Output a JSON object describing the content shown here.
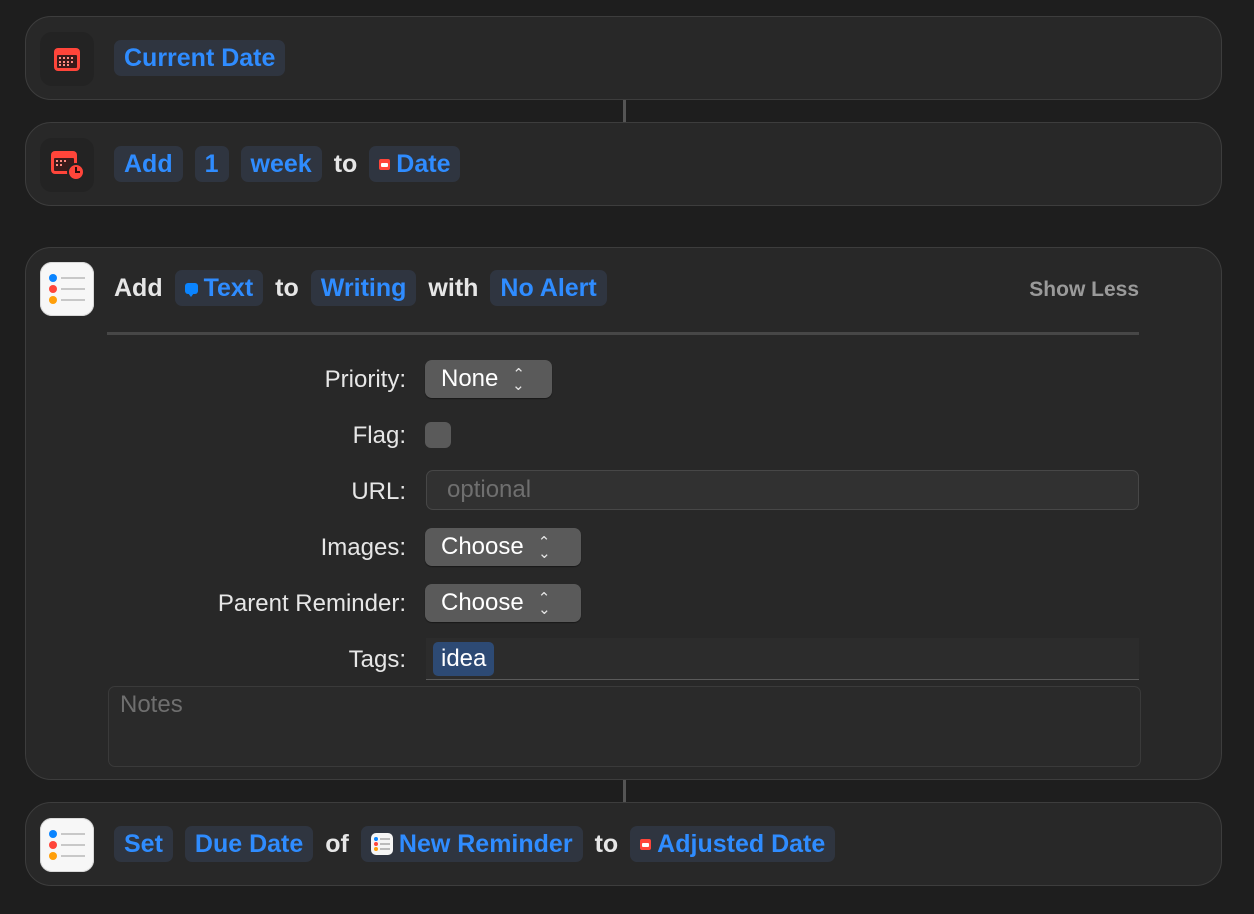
{
  "action1": {
    "icon": "calendar-icon",
    "token": "Current Date"
  },
  "action2": {
    "icon": "calendar-clock-icon",
    "add": "Add",
    "amount": "1",
    "unit": "week",
    "to": "to",
    "date_token": "Date"
  },
  "action3": {
    "icon": "reminders-icon",
    "add": "Add",
    "text_token": "Text",
    "to": "to",
    "list_token": "Writing",
    "with": "with",
    "alert_token": "No Alert",
    "show_less": "Show Less",
    "priority_label": "Priority:",
    "priority_value": "None",
    "flag_label": "Flag:",
    "url_label": "URL:",
    "url_placeholder": "optional",
    "images_label": "Images:",
    "images_value": "Choose",
    "parent_label": "Parent Reminder:",
    "parent_value": "Choose",
    "tags_label": "Tags:",
    "tag_value": "idea",
    "notes_placeholder": "Notes"
  },
  "action4": {
    "icon": "reminders-icon",
    "set": "Set",
    "field_token": "Due Date",
    "of": "of",
    "reminder_token": "New Reminder",
    "to": "to",
    "date_token": "Adjusted Date"
  },
  "colors": {
    "background": "#1e1e1e",
    "card": "#282828",
    "token_text": "#2f8cff",
    "token_bg": "#2f3540",
    "calendar_red": "#ff453a",
    "tag_bg": "#2d4a74"
  }
}
